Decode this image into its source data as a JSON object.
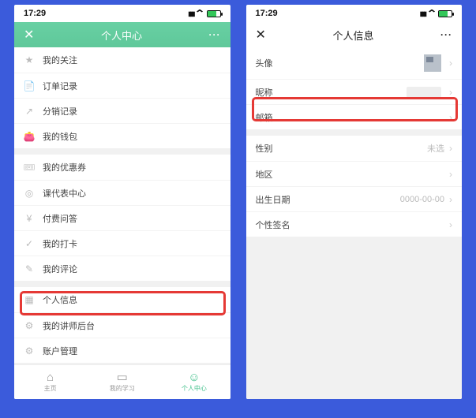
{
  "status": {
    "time": "17:29"
  },
  "phoneA": {
    "nav_title": "个人中心",
    "group1": [
      {
        "icon": "★",
        "label": "我的关注"
      },
      {
        "icon": "📄",
        "label": "订单记录"
      },
      {
        "icon": "↗",
        "label": "分销记录"
      },
      {
        "icon": "👛",
        "label": "我的钱包"
      }
    ],
    "group2": [
      {
        "icon": "🎟",
        "label": "我的优惠券"
      },
      {
        "icon": "◎",
        "label": "课代表中心"
      },
      {
        "icon": "¥",
        "label": "付费问答"
      },
      {
        "icon": "✓",
        "label": "我的打卡"
      },
      {
        "icon": "✎",
        "label": "我的评论"
      }
    ],
    "group3": [
      {
        "icon": "▦",
        "label": "个人信息"
      },
      {
        "icon": "⚙",
        "label": "我的讲师后台"
      },
      {
        "icon": "⚙",
        "label": "账户管理"
      }
    ],
    "tabs": [
      {
        "icon": "⌂",
        "label": "主页"
      },
      {
        "icon": "▭",
        "label": "我的学习"
      },
      {
        "icon": "☺",
        "label": "个人中心"
      }
    ]
  },
  "phoneB": {
    "nav_title": "个人信息",
    "rows": {
      "avatar_label": "头像",
      "nickname_label": "昵称",
      "email_label": "邮箱",
      "gender_label": "性别",
      "gender_value": "未选",
      "region_label": "地区",
      "birth_label": "出生日期",
      "birth_value": "0000-00-00",
      "bio_label": "个性签名"
    }
  }
}
